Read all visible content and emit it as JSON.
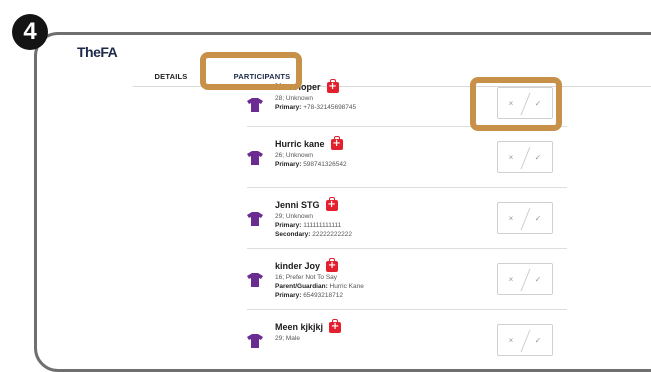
{
  "step_number": "4",
  "app": {
    "logo": "TheFA"
  },
  "tabs": [
    {
      "label": "DETAILS"
    },
    {
      "label": "PARTICIPANTS"
    }
  ],
  "colors": {
    "accent": "#c8914a",
    "shirt": "#6b2c91",
    "medical": "#e3202d",
    "brand": "#1d2a4a"
  },
  "icons": {
    "shirt": "shirt-icon",
    "medical": "medical-bag-icon",
    "cross": "cross-icon",
    "check": "check-icon"
  },
  "participants": [
    {
      "name": "Neo Hoper",
      "lines": [
        {
          "label": "",
          "value": "28; Unknown"
        },
        {
          "label": "Primary:",
          "value": "+78-32145698745"
        }
      ]
    },
    {
      "name": "Hurric kane",
      "lines": [
        {
          "label": "",
          "value": "26; Unknown"
        },
        {
          "label": "Primary:",
          "value": "598741326542"
        }
      ]
    },
    {
      "name": "Jenni STG",
      "lines": [
        {
          "label": "",
          "value": "29; Unknown"
        },
        {
          "label": "Primary:",
          "value": "111111111111"
        },
        {
          "label": "Secondary:",
          "value": "22222222222"
        }
      ]
    },
    {
      "name": "kinder Joy",
      "lines": [
        {
          "label": "",
          "value": "16; Prefer Not To Say"
        },
        {
          "label": "Parent/Guardian:",
          "value": "Hurric Kane"
        },
        {
          "label": "Primary:",
          "value": "65493218712"
        }
      ]
    },
    {
      "name": "Meen kjkjkj",
      "lines": [
        {
          "label": "",
          "value": "29; Male"
        }
      ]
    }
  ],
  "attendance": {
    "cross": "×",
    "check": "✓"
  }
}
